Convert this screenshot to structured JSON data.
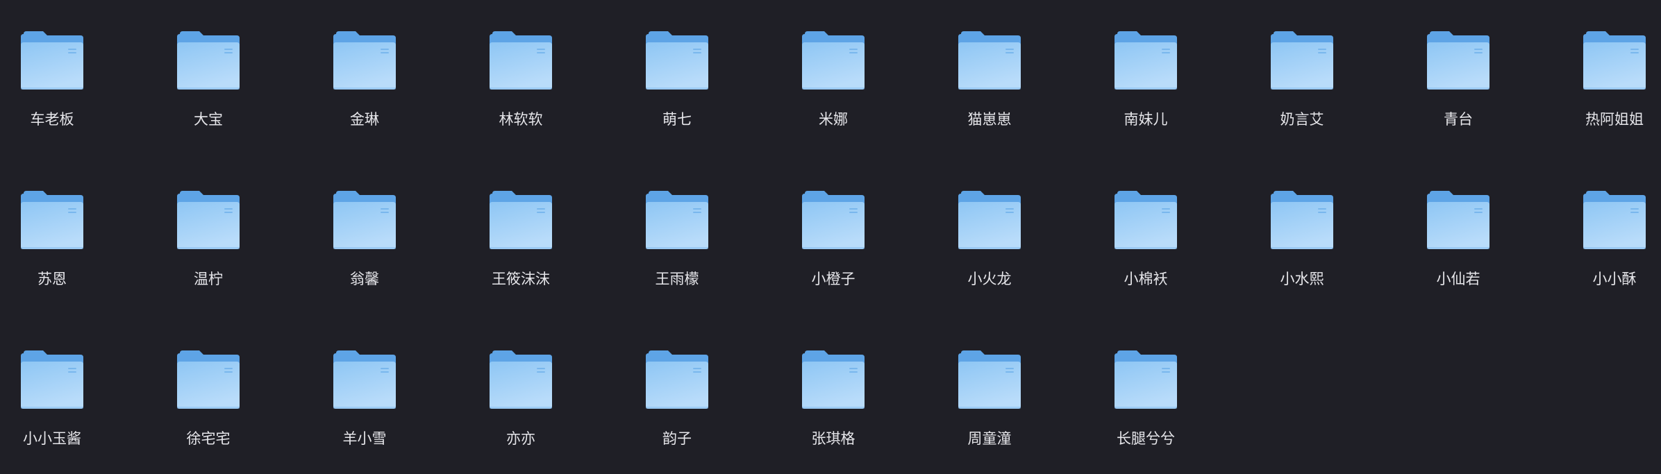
{
  "folders": [
    {
      "name": "车老板"
    },
    {
      "name": "大宝"
    },
    {
      "name": "金琳"
    },
    {
      "name": "林软软"
    },
    {
      "name": "萌七"
    },
    {
      "name": "米娜"
    },
    {
      "name": "猫崽崽"
    },
    {
      "name": "南妹儿"
    },
    {
      "name": "奶言艾"
    },
    {
      "name": "青台"
    },
    {
      "name": "热阿姐姐"
    },
    {
      "name": "苏恩"
    },
    {
      "name": "温柠"
    },
    {
      "name": "翁馨"
    },
    {
      "name": "王筱沫沫"
    },
    {
      "name": "王雨檬"
    },
    {
      "name": "小橙子"
    },
    {
      "name": "小火龙"
    },
    {
      "name": "小棉袄"
    },
    {
      "name": "小水熙"
    },
    {
      "name": "小仙若"
    },
    {
      "name": "小小酥"
    },
    {
      "name": "小小玉酱"
    },
    {
      "name": "徐宅宅"
    },
    {
      "name": "羊小雪"
    },
    {
      "name": "亦亦"
    },
    {
      "name": "韵子"
    },
    {
      "name": "张琪格"
    },
    {
      "name": "周童潼"
    },
    {
      "name": "长腿兮兮"
    }
  ],
  "icon": "folder-icon",
  "colors": {
    "background": "#1f1f26",
    "folder_back": "#5ea4e6",
    "folder_front_top": "#8ec6f4",
    "folder_front_bottom": "#b9dcfa",
    "label_text": "#e6e6ea"
  }
}
